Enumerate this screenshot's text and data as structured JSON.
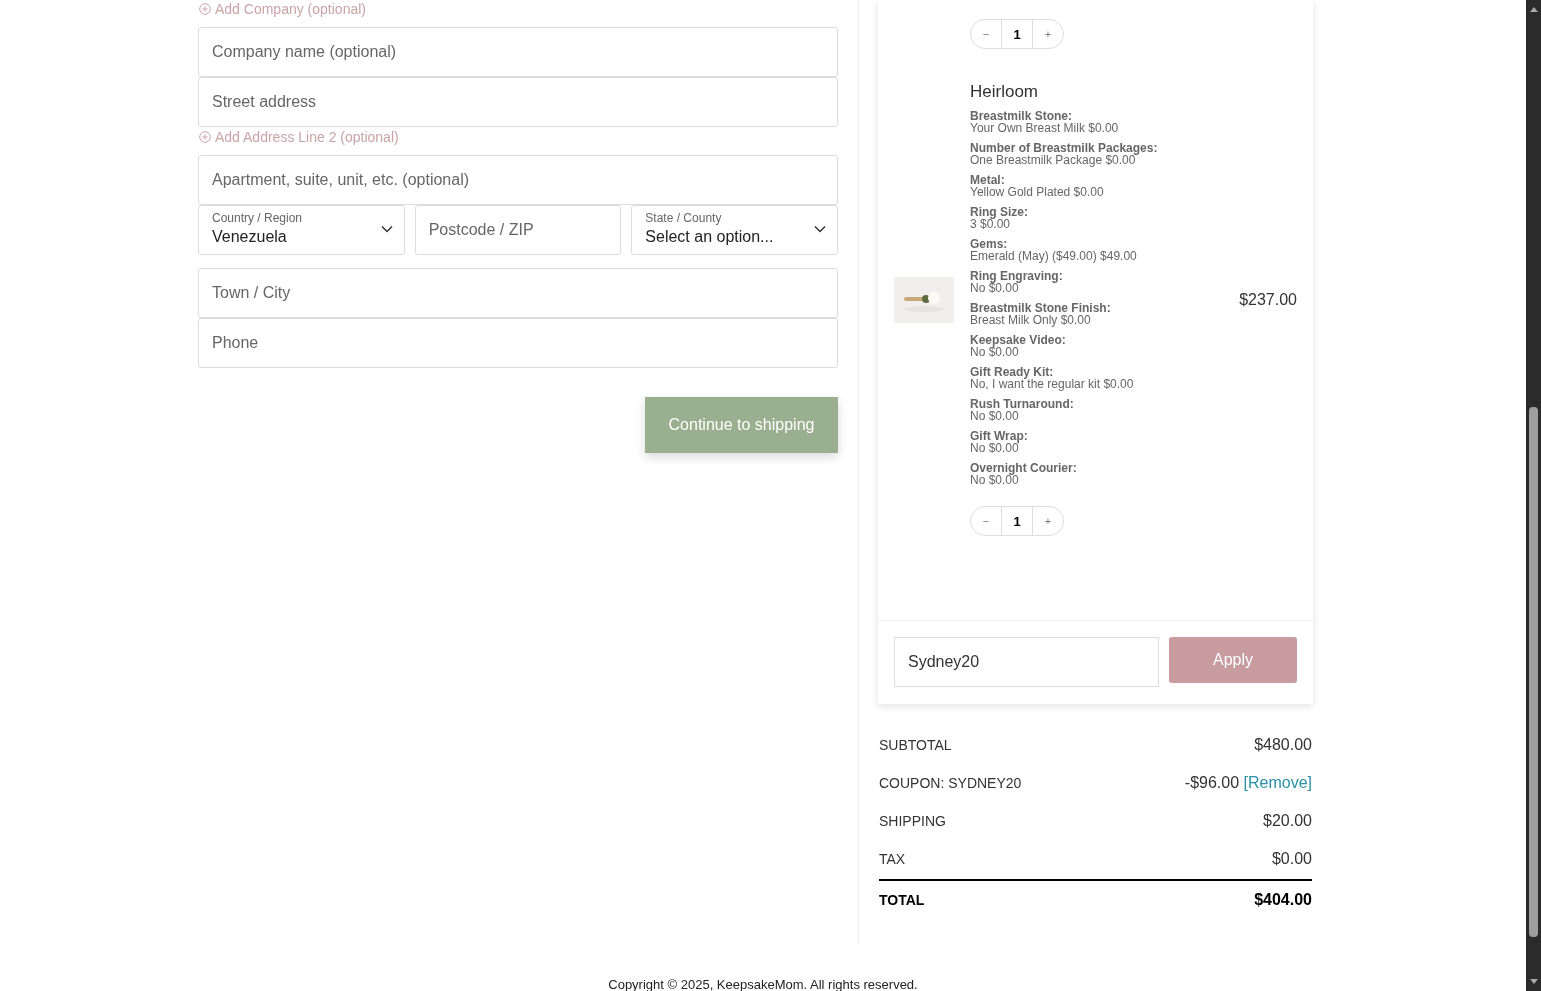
{
  "billing": {
    "add_company_link": "Add Company (optional)",
    "fields": [
      {
        "kind": "text",
        "placeholder": "Company name (optional)"
      },
      {
        "kind": "text",
        "placeholder": "Street address"
      },
      {
        "kind": "link",
        "label": "Add Address Line 2 (optional)"
      },
      {
        "kind": "text",
        "placeholder": "Apartment, suite, unit, etc. (optional)"
      },
      {
        "kind": "row",
        "items": [
          {
            "kind": "select",
            "label": "Country / Region",
            "value": "Venezuela"
          },
          {
            "kind": "text",
            "placeholder": "Postcode / ZIP"
          },
          {
            "kind": "select",
            "label": "State / County",
            "value": "Select an option..."
          }
        ]
      },
      {
        "kind": "text",
        "placeholder": "Town / City"
      },
      {
        "kind": "text",
        "placeholder": "Phone"
      }
    ],
    "continue_button": "Continue to shipping"
  },
  "cart": {
    "prev_item_quantity": {
      "minus": "−",
      "value": "1",
      "plus": "+"
    },
    "item": {
      "name": "Heirloom",
      "price": "$237.00",
      "options": [
        {
          "label": "Breastmilk Stone:",
          "value": "Your Own Breast Milk $0.00"
        },
        {
          "label": "Number of Breastmilk Packages:",
          "value": "One Breastmilk Package $0.00"
        },
        {
          "label": "Metal:",
          "value": "Yellow Gold Plated $0.00"
        },
        {
          "label": "Ring Size:",
          "value": "3 $0.00"
        },
        {
          "label": "Gems:",
          "value": "Emerald (May) ($49.00) $49.00"
        },
        {
          "label": "Ring Engraving:",
          "value": "No $0.00"
        },
        {
          "label": "Breastmilk Stone Finish:",
          "value": "Breast Milk Only $0.00"
        },
        {
          "label": "Keepsake Video:",
          "value": "No $0.00"
        },
        {
          "label": "Gift Ready Kit:",
          "value": "No, I want the regular kit $0.00"
        },
        {
          "label": "Rush Turnaround:",
          "value": "No $0.00"
        },
        {
          "label": "Gift Wrap:",
          "value": "No $0.00"
        },
        {
          "label": "Overnight Courier:",
          "value": "No $0.00"
        }
      ],
      "quantity": {
        "minus": "−",
        "value": "1",
        "plus": "+"
      }
    },
    "coupon": {
      "value": "Sydney20",
      "button": "Apply"
    },
    "totals": [
      {
        "kind": "plain",
        "label": "SUBTOTAL",
        "value": "$480.00"
      },
      {
        "kind": "coupon",
        "label": "COUPON: SYDNEY20",
        "value": "-$96.00",
        "link": "[Remove]"
      },
      {
        "kind": "plain",
        "label": "SHIPPING",
        "value": "$20.00"
      },
      {
        "kind": "plain",
        "label": "TAX",
        "value": "$0.00"
      },
      {
        "kind": "total",
        "label": "TOTAL",
        "value": "$404.00"
      }
    ]
  },
  "footer": {
    "copyright": "Copyright © 2025, KeepsakeMom. All rights reserved."
  }
}
